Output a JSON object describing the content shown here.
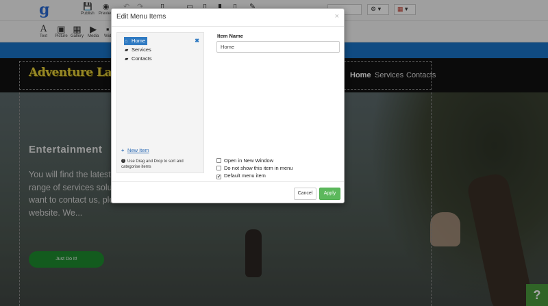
{
  "toolbar": {
    "publish": "Publish",
    "preview": "Preview",
    "row2": [
      "Text",
      "Picture",
      "Gallery",
      "Media",
      "Wid"
    ],
    "icons": [
      "save-icon",
      "eye-icon",
      "undo-icon",
      "redo-icon",
      "page-icon",
      "desktop-icon",
      "tablet-icon",
      "mobile-icon",
      "magic-icon",
      "gear-icon",
      "flag-uk-icon"
    ]
  },
  "site": {
    "brand": "Adventure Land",
    "nav": [
      "Home",
      "Services",
      "Contacts"
    ],
    "hero_title": "Entertainment",
    "hero_text": "You will find the latest Our company is consta wide range of services solution that helps everyone. If you want to contact us, please fill the contact form on our website. We...",
    "hero_button": "Just Do It!",
    "help": "?"
  },
  "modal": {
    "title": "Edit Menu Items",
    "close": "×",
    "tree": [
      "Home",
      "Services",
      "Contacts"
    ],
    "delete": "✖",
    "new_item": "New Item",
    "hint": "Use Drag and Drop to sort and categorise items",
    "field_label": "Item Name",
    "field_value": "Home",
    "checks": [
      {
        "label": "Open in New Window",
        "checked": false
      },
      {
        "label": "Do not show this item in menu",
        "checked": false
      },
      {
        "label": "Default menu item",
        "checked": true
      }
    ],
    "cancel": "Cancel",
    "apply": "Apply"
  }
}
